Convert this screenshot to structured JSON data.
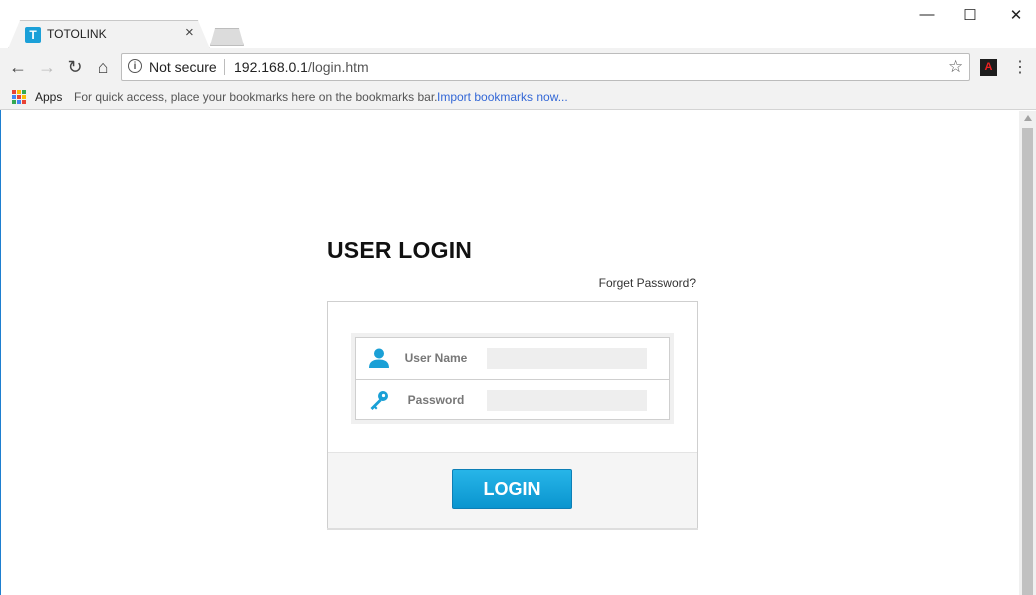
{
  "browser": {
    "tab_title": "TOTOLINK",
    "favicon_letter": "T",
    "tab_close": "×",
    "window_controls": {
      "minimize": "—",
      "maximize": "☐",
      "close": "✕"
    },
    "nav": {
      "back": "←",
      "forward": "→",
      "reload": "↻",
      "home": "⌂"
    },
    "security_label": "Not secure",
    "url_host": "192.168.0.1",
    "url_path": "/login.htm",
    "bookmark_star": "☆",
    "pdf_icon": "A",
    "menu_icon": "⋮",
    "bookmarks_bar": {
      "apps_label": "Apps",
      "hint_text": "For quick access, place your bookmarks here on the bookmarks bar.",
      "import_link": "Import bookmarks now..."
    }
  },
  "login_page": {
    "title": "USER LOGIN",
    "forget_password": "Forget Password?",
    "fields": [
      {
        "label": "User Name",
        "value": "",
        "icon": "user-icon"
      },
      {
        "label": "Password",
        "value": "",
        "icon": "key-icon"
      }
    ],
    "login_button": "LOGIN"
  },
  "colors": {
    "accent": "#0a95cf",
    "icon_blue": "#1aa0d6",
    "favicon": "#1ba0d8"
  }
}
